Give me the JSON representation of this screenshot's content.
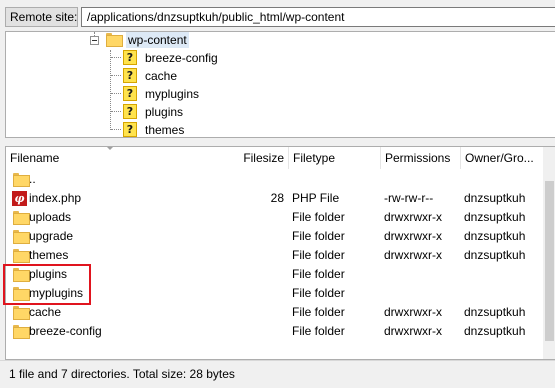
{
  "site_bar": {
    "label": "Remote site:",
    "path": "/applications/dnzsuptkuh/public_html/wp-content"
  },
  "tree": {
    "parent": {
      "name": "wp-content",
      "icon": "folder-icon",
      "expanded": true
    },
    "children": [
      {
        "name": "breeze-config",
        "icon": "question-icon"
      },
      {
        "name": "cache",
        "icon": "question-icon"
      },
      {
        "name": "myplugins",
        "icon": "question-icon"
      },
      {
        "name": "plugins",
        "icon": "question-icon"
      },
      {
        "name": "themes",
        "icon": "question-icon"
      }
    ]
  },
  "list": {
    "columns": {
      "filename": "Filename",
      "filesize": "Filesize",
      "filetype": "Filetype",
      "permissions": "Permissions",
      "owner": "Owner/Gro..."
    },
    "rows": [
      {
        "icon": "folder-icon",
        "name": "..",
        "size": "",
        "type": "",
        "perm": "",
        "owner": ""
      },
      {
        "icon": "php-file-icon",
        "name": "index.php",
        "size": "28",
        "type": "PHP File",
        "perm": "-rw-rw-r--",
        "owner": "dnzsuptkuh"
      },
      {
        "icon": "folder-icon",
        "name": "uploads",
        "size": "",
        "type": "File folder",
        "perm": "drwxrwxr-x",
        "owner": "dnzsuptkuh"
      },
      {
        "icon": "folder-icon",
        "name": "upgrade",
        "size": "",
        "type": "File folder",
        "perm": "drwxrwxr-x",
        "owner": "dnzsuptkuh"
      },
      {
        "icon": "folder-icon",
        "name": "themes",
        "size": "",
        "type": "File folder",
        "perm": "drwxrwxr-x",
        "owner": "dnzsuptkuh"
      },
      {
        "icon": "folder-icon",
        "name": "plugins",
        "size": "",
        "type": "File folder",
        "perm": "",
        "owner": ""
      },
      {
        "icon": "folder-icon",
        "name": "myplugins",
        "size": "",
        "type": "File folder",
        "perm": "",
        "owner": ""
      },
      {
        "icon": "folder-icon",
        "name": "cache",
        "size": "",
        "type": "File folder",
        "perm": "drwxrwxr-x",
        "owner": "dnzsuptkuh"
      },
      {
        "icon": "folder-icon",
        "name": "breeze-config",
        "size": "",
        "type": "File folder",
        "perm": "drwxrwxr-x",
        "owner": "dnzsuptkuh"
      }
    ]
  },
  "status": "1 file and 7 directories. Total size: 28 bytes",
  "colors": {
    "highlight_box": "#e0141e",
    "folder": "#ffd766",
    "php_icon": "#c21a1a",
    "tree_selected": "#dde9f6"
  }
}
